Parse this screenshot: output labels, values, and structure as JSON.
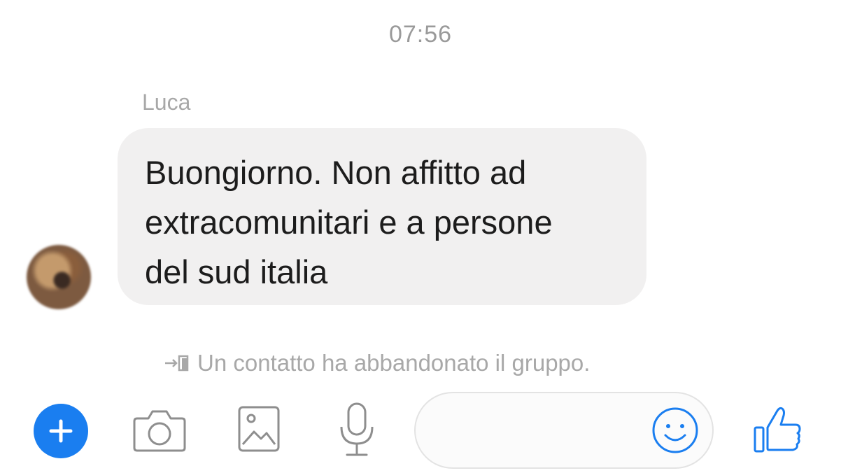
{
  "conversation": {
    "timestamp": "07:56",
    "messages": [
      {
        "sender": "Luca",
        "text_lines": [
          "Buongiorno. Non affitto ad",
          "extracomunitari e a persone",
          "del sud italia"
        ]
      }
    ],
    "system_notice": "Un contatto ha abbandonato il gruppo."
  },
  "composer": {
    "message_value": "",
    "message_placeholder": "",
    "icons": {
      "add": "plus-icon",
      "camera": "camera-icon",
      "gallery": "image-icon",
      "voice": "microphone-icon",
      "emoji": "smiley-icon",
      "like": "thumbs-up-icon"
    }
  },
  "colors": {
    "accent": "#1a7ef0",
    "bubble_background": "#f1f0f0",
    "muted_text": "#a8a8a8",
    "message_text": "#1c1c1c",
    "icon_gray": "#8e8e8e"
  }
}
